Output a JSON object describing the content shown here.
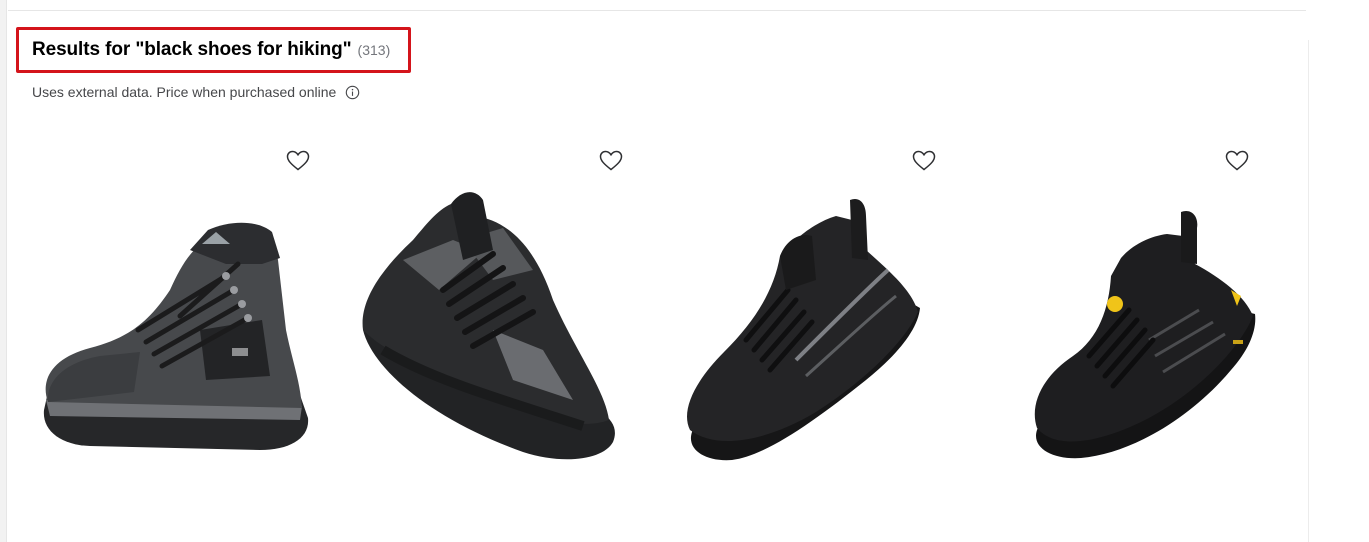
{
  "results": {
    "title": "Results for \"black shoes for hiking\"",
    "count": "(313)",
    "subtitle": "Uses external data. Price when purchased online"
  },
  "icons": {
    "info": "info-circle-icon",
    "favorite": "heart-outline-icon"
  },
  "colors": {
    "highlight_border": "#d4141b",
    "shoe_black": "#1a1a1a",
    "shoe_gray": "#5b5d60"
  },
  "products": [
    {
      "image": "gray-black-hiking-boot",
      "favorite": "heart-outline-icon"
    },
    {
      "image": "black-gray-hiking-shoe",
      "favorite": "heart-outline-icon"
    },
    {
      "image": "black-knit-trail-runner",
      "favorite": "heart-outline-icon"
    },
    {
      "image": "black-leather-hiking-shoe-yellow-accents",
      "favorite": "heart-outline-icon"
    }
  ]
}
